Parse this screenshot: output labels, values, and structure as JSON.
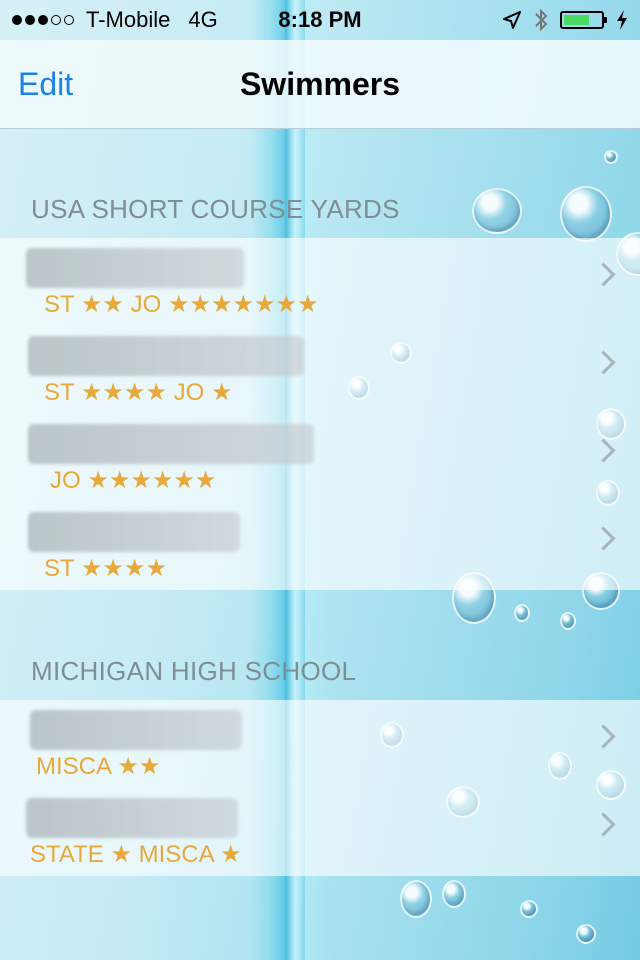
{
  "status": {
    "carrier": "T-Mobile",
    "network": "4G",
    "time": "8:18 PM",
    "signal_full": 3,
    "signal_total": 5
  },
  "nav": {
    "edit_label": "Edit",
    "title": "Swimmers"
  },
  "sections": [
    {
      "header": "USA SHORT COURSE YARDS",
      "rows": [
        {
          "ratings": "ST ★★ JO ★★★★★★★"
        },
        {
          "ratings": "ST ★★★★ JO ★"
        },
        {
          "ratings": "JO ★★★★★★"
        },
        {
          "ratings": "ST ★★★★"
        }
      ]
    },
    {
      "header": "MICHIGAN HIGH SCHOOL",
      "rows": [
        {
          "ratings": "MISCA ★★"
        },
        {
          "ratings": "STATE ★ MISCA ★"
        }
      ]
    }
  ],
  "colors": {
    "accent": "#1a82e8",
    "rating": "#e8a93c",
    "section_header": "#7f8e95",
    "battery": "#4cd964"
  }
}
